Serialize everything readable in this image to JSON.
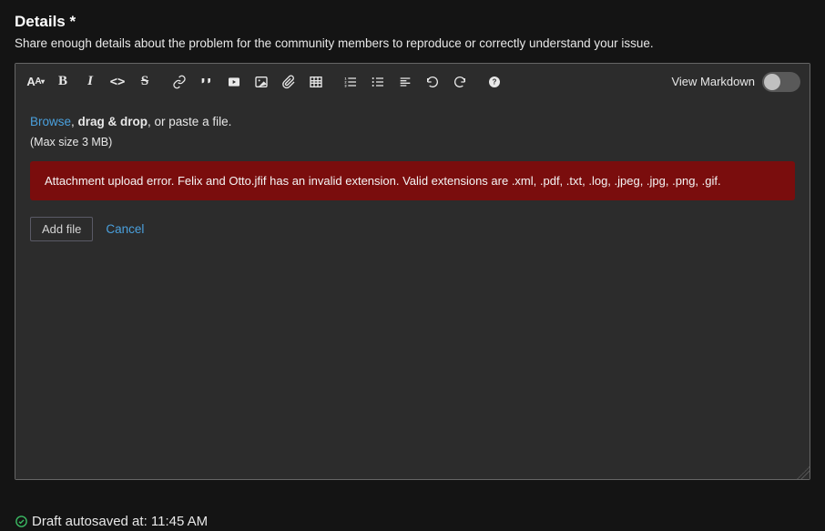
{
  "header": {
    "title": "Details *",
    "subtitle": "Share enough details about the problem for the community members to reproduce or correctly understand your issue."
  },
  "toolbar": {
    "view_markdown_label": "View Markdown"
  },
  "dropzone": {
    "browse": "Browse",
    "drag": "drag & drop",
    "paste": ", or paste a file.",
    "maxsize": "(Max size 3 MB)"
  },
  "error": {
    "message": "Attachment upload error. Felix and Otto.jfif has an invalid extension. Valid extensions are .xml, .pdf, .txt, .log, .jpeg, .jpg, .png, .gif."
  },
  "actions": {
    "add_file": "Add file",
    "cancel": "Cancel"
  },
  "autosave": {
    "prefix": "Draft autosaved at: ",
    "time": "11:45 AM"
  }
}
